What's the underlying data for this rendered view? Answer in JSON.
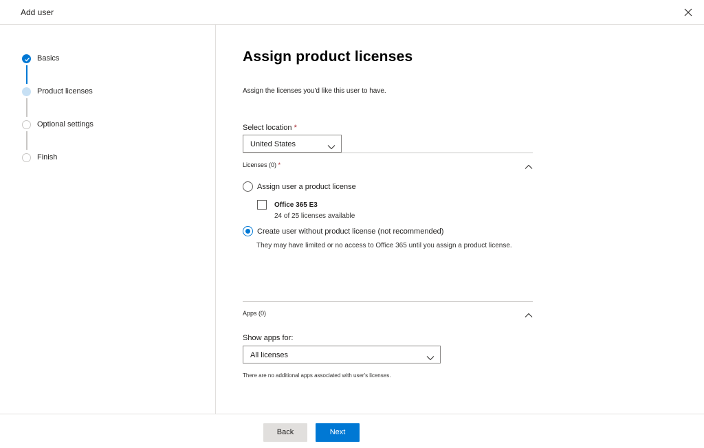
{
  "header": {
    "title": "Add user"
  },
  "steps": [
    {
      "label": "Basics",
      "state": "done"
    },
    {
      "label": "Product licenses",
      "state": "current"
    },
    {
      "label": "Optional settings",
      "state": "pending"
    },
    {
      "label": "Finish",
      "state": "pending"
    }
  ],
  "main": {
    "title": "Assign product licenses",
    "description": "Assign the licenses you'd like this user to have.",
    "location": {
      "label": "Select location",
      "required_mark": "*",
      "value": "United States"
    },
    "licenses": {
      "heading": "Licenses (0)",
      "required_mark": "*",
      "assign_option": "Assign user a product license",
      "license_name": "Office 365 E3",
      "license_available": "24 of 25 licenses available",
      "no_license_option": "Create user without product license (not recommended)",
      "no_license_desc": "They may have limited or no access to Office 365 until you assign a product license.",
      "selected": "no_license"
    },
    "apps": {
      "heading": "Apps (0)",
      "show_label": "Show apps for:",
      "show_value": "All licenses",
      "note": "There are no additional apps associated with user's licenses."
    }
  },
  "footer": {
    "back_label": "Back",
    "next_label": "Next"
  },
  "colors": {
    "accent": "#0078d4",
    "divider": "#e1dfdd",
    "required": "#a4262c"
  },
  "icons": {
    "close": "close-icon",
    "check": "checkmark-icon",
    "chevron_down": "chevron-down-icon",
    "chevron_up": "chevron-up-icon"
  }
}
